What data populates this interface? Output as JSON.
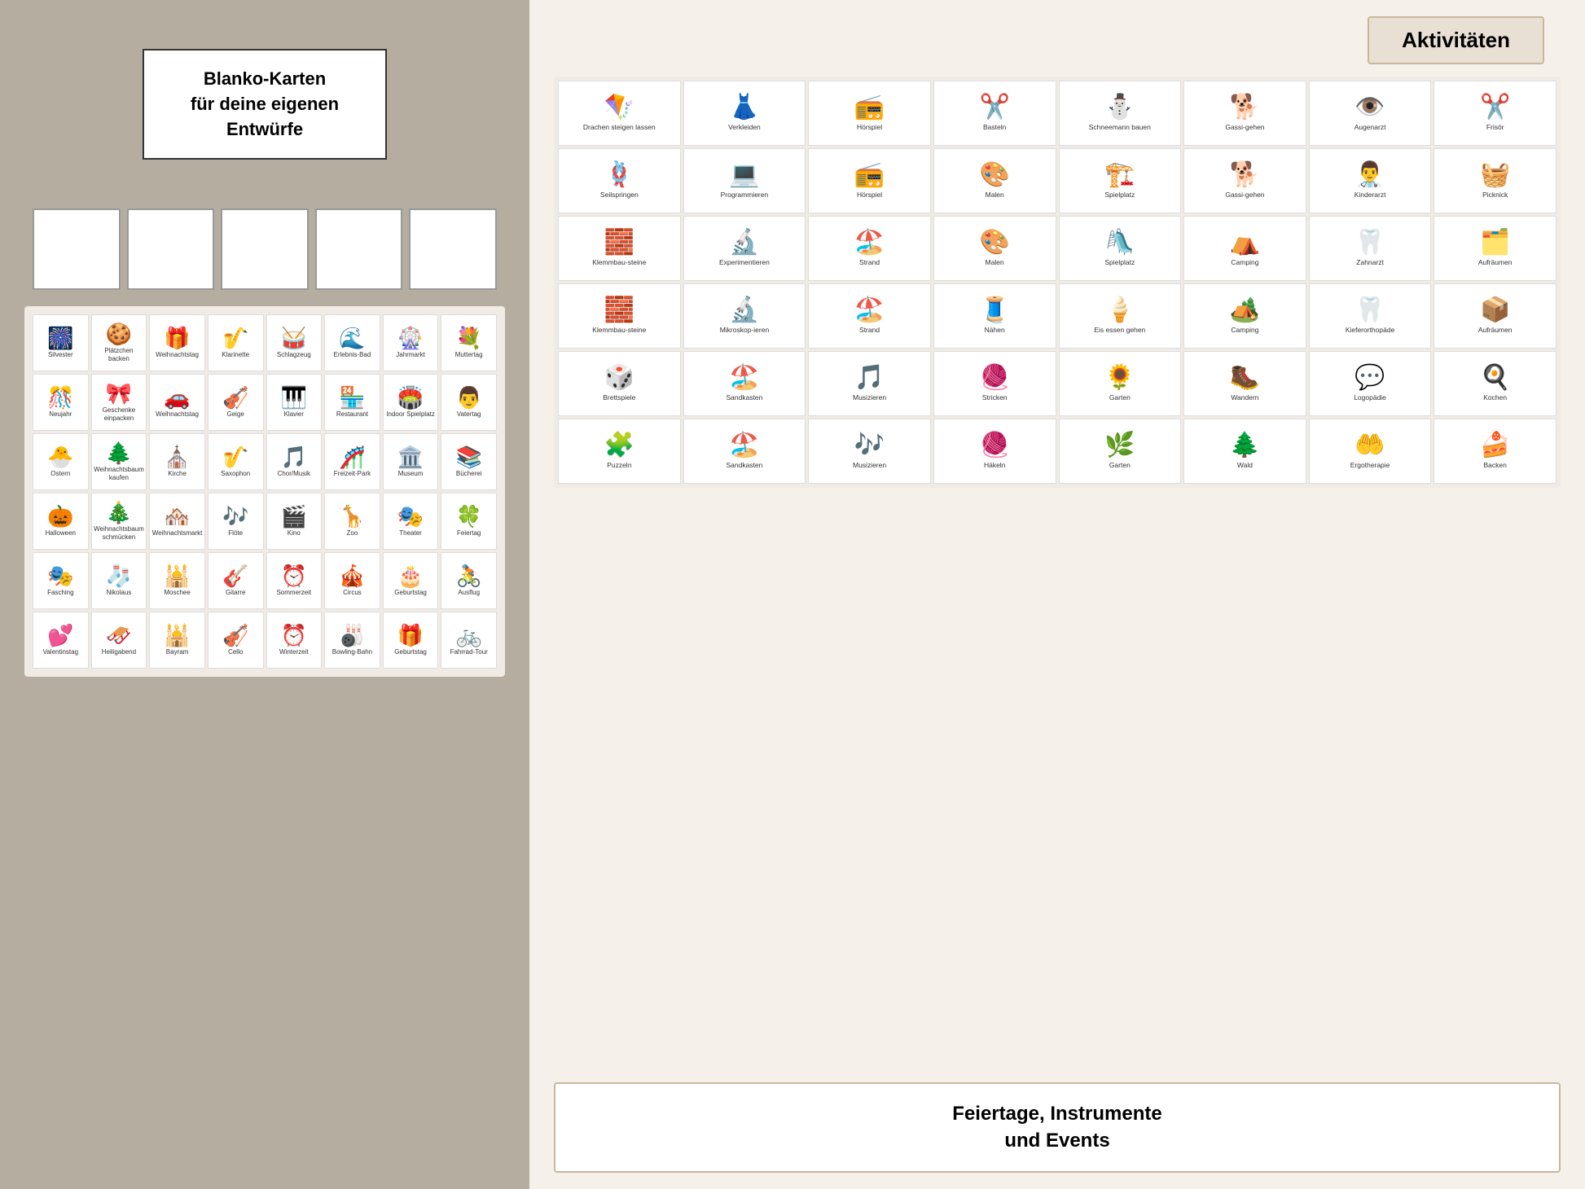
{
  "left": {
    "blanko": {
      "title": "Blanko-Karten\nfür deine eigenen\nEntwürfe"
    },
    "cards": [
      {
        "label": "Silvester",
        "icon": "🎆"
      },
      {
        "label": "Plätzchen backen",
        "icon": "🍪"
      },
      {
        "label": "Weihnachtstag",
        "icon": "🎁"
      },
      {
        "label": "Klarinette",
        "icon": "🎷"
      },
      {
        "label": "Schlagzeug",
        "icon": "🥁"
      },
      {
        "label": "Erlebnis-Bad",
        "icon": "🌊"
      },
      {
        "label": "Jahrmarkt",
        "icon": "🎡"
      },
      {
        "label": "Muttertag",
        "icon": "💐"
      },
      {
        "label": "Neujahr",
        "icon": "🎊"
      },
      {
        "label": "Geschenke einpacken",
        "icon": "🎀"
      },
      {
        "label": "Weihnachtstag",
        "icon": "🚗"
      },
      {
        "label": "Geige",
        "icon": "🎻"
      },
      {
        "label": "Klavier",
        "icon": "🎹"
      },
      {
        "label": "Restaurant",
        "icon": "🏪"
      },
      {
        "label": "Indoor Spielplatz",
        "icon": "🏟️"
      },
      {
        "label": "Vatertag",
        "icon": "👨"
      },
      {
        "label": "Ostern",
        "icon": "🐣"
      },
      {
        "label": "Weihnachtsbaum kaufen",
        "icon": "🌲"
      },
      {
        "label": "Kirche",
        "icon": "⛪"
      },
      {
        "label": "Saxophon",
        "icon": "🎷"
      },
      {
        "label": "Chor/Musik",
        "icon": "🎵"
      },
      {
        "label": "Freizeit-Park",
        "icon": "🎢"
      },
      {
        "label": "Museum",
        "icon": "🏛️"
      },
      {
        "label": "Bücherei",
        "icon": "📚"
      },
      {
        "label": "Halloween",
        "icon": "🎃"
      },
      {
        "label": "Weihnachtsbaum schmücken",
        "icon": "🎄"
      },
      {
        "label": "Weihnachtsmarkt",
        "icon": "🏘️"
      },
      {
        "label": "Flöte",
        "icon": "🎶"
      },
      {
        "label": "Kino",
        "icon": "🎬"
      },
      {
        "label": "Zoo",
        "icon": "🦒"
      },
      {
        "label": "Theater",
        "icon": "🎭"
      },
      {
        "label": "Feiertag",
        "icon": "🍀"
      },
      {
        "label": "Fasching",
        "icon": "🎭"
      },
      {
        "label": "Nikolaus",
        "icon": "🧦"
      },
      {
        "label": "Moschee",
        "icon": "🕌"
      },
      {
        "label": "Gitarre",
        "icon": "🎸"
      },
      {
        "label": "Sommerzeit",
        "icon": "⏰"
      },
      {
        "label": "Circus",
        "icon": "🎪"
      },
      {
        "label": "Geburtstag",
        "icon": "🎂"
      },
      {
        "label": "Ausflug",
        "icon": "🚴"
      },
      {
        "label": "Valentinstag",
        "icon": "💕"
      },
      {
        "label": "Heiligabend",
        "icon": "🛷"
      },
      {
        "label": "Bayram",
        "icon": "🕌"
      },
      {
        "label": "Cello",
        "icon": "🎻"
      },
      {
        "label": "Winterzeit",
        "icon": "⏰"
      },
      {
        "label": "Bowling-Bahn",
        "icon": "🎳"
      },
      {
        "label": "Geburtstag",
        "icon": "🎁"
      },
      {
        "label": "Fahrrad-Tour",
        "icon": "🚲"
      }
    ]
  },
  "right": {
    "aktivitaeten_title": "Aktivitäten",
    "activities": [
      {
        "label": "Drachen steigen lassen",
        "icon": "🪁"
      },
      {
        "label": "Verkleiden",
        "icon": "👗"
      },
      {
        "label": "Hörspiel",
        "icon": "📻"
      },
      {
        "label": "Basteln",
        "icon": "✂️"
      },
      {
        "label": "Schneemann bauen",
        "icon": "⛄"
      },
      {
        "label": "Gassi-gehen",
        "icon": "🐕"
      },
      {
        "label": "Augenarzt",
        "icon": "👁️"
      },
      {
        "label": "Frisör",
        "icon": "✂️"
      },
      {
        "label": "Seilspringen",
        "icon": "🪢"
      },
      {
        "label": "Programmieren",
        "icon": "💻"
      },
      {
        "label": "Hörspiel",
        "icon": "📻"
      },
      {
        "label": "Malen",
        "icon": "🎨"
      },
      {
        "label": "Spielplatz",
        "icon": "🏗️"
      },
      {
        "label": "Gassi-gehen",
        "icon": "🐕"
      },
      {
        "label": "Kinderarzt",
        "icon": "👨‍⚕️"
      },
      {
        "label": "Picknick",
        "icon": "🧺"
      },
      {
        "label": "Klemmbau-steine",
        "icon": "🧱"
      },
      {
        "label": "Experimentieren",
        "icon": "🔬"
      },
      {
        "label": "Strand",
        "icon": "🏖️"
      },
      {
        "label": "Malen",
        "icon": "🎨"
      },
      {
        "label": "Spielplatz",
        "icon": "🛝"
      },
      {
        "label": "Camping",
        "icon": "⛺"
      },
      {
        "label": "Zahnarzt",
        "icon": "🦷"
      },
      {
        "label": "Aufräumen",
        "icon": "🗂️"
      },
      {
        "label": "Klemmbau-steine",
        "icon": "🧱"
      },
      {
        "label": "Mikroskop-ieren",
        "icon": "🔬"
      },
      {
        "label": "Strand",
        "icon": "🏖️"
      },
      {
        "label": "Nähen",
        "icon": "🧵"
      },
      {
        "label": "Eis essen gehen",
        "icon": "🍦"
      },
      {
        "label": "Camping",
        "icon": "🏕️"
      },
      {
        "label": "Kieferorthopäde",
        "icon": "🦷"
      },
      {
        "label": "Aufräumen",
        "icon": "📦"
      },
      {
        "label": "Brettspiele",
        "icon": "🎲"
      },
      {
        "label": "Sandkasten",
        "icon": "🏖️"
      },
      {
        "label": "Musizieren",
        "icon": "🎵"
      },
      {
        "label": "Stricken",
        "icon": "🧶"
      },
      {
        "label": "Garten",
        "icon": "🌻"
      },
      {
        "label": "Wandern",
        "icon": "🥾"
      },
      {
        "label": "Logopädie",
        "icon": "💬"
      },
      {
        "label": "Kochen",
        "icon": "🍳"
      },
      {
        "label": "Puzzeln",
        "icon": "🧩"
      },
      {
        "label": "Sandkasten",
        "icon": "🏖️"
      },
      {
        "label": "Musizieren",
        "icon": "🎶"
      },
      {
        "label": "Häkeln",
        "icon": "🧶"
      },
      {
        "label": "Garten",
        "icon": "🌿"
      },
      {
        "label": "Wald",
        "icon": "🌲"
      },
      {
        "label": "Ergotherapie",
        "icon": "🤲"
      },
      {
        "label": "Backen",
        "icon": "🍰"
      }
    ],
    "feiertage_title": "Feiertage, Instrumente\nund Events"
  }
}
